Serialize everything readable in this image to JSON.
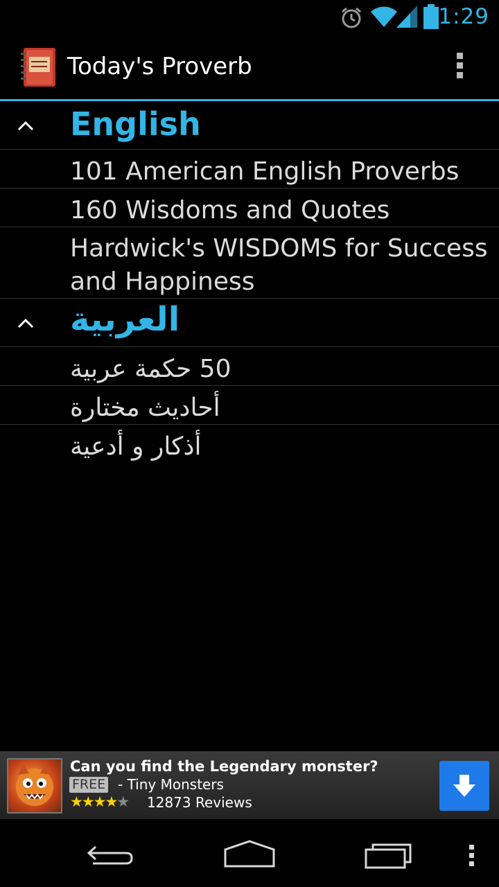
{
  "status_bar": {
    "time": "1:29",
    "icons": [
      "alarm-icon",
      "wifi-icon",
      "signal-icon",
      "battery-icon"
    ],
    "accent_color": "#33b5e5"
  },
  "action_bar": {
    "title": "Today's Proverb",
    "app_icon": "notebook-icon",
    "menu_icon": "overflow-menu-icon"
  },
  "groups": [
    {
      "label": "English",
      "expanded": true,
      "items": [
        "101 American English Proverbs",
        "160 Wisdoms and Quotes",
        "Hardwick's WISDOMS for Success and Happiness"
      ]
    },
    {
      "label": "العربية",
      "expanded": true,
      "items": [
        "50 حكمة عربية",
        "أحاديث مختارة",
        "أذكار و أدعية"
      ]
    }
  ],
  "ad": {
    "title": "Can you find the Legendary monster?",
    "badge": "FREE",
    "developer": "- Tiny Monsters",
    "rating_stars": 4,
    "rating_max": 5,
    "reviews": "12873 Reviews",
    "button_color": "#1e7ae8",
    "button_icon": "download-arrow-icon"
  },
  "nav_bar": {
    "buttons": [
      "back-icon",
      "home-icon",
      "recent-apps-icon",
      "menu-dots-icon"
    ]
  }
}
